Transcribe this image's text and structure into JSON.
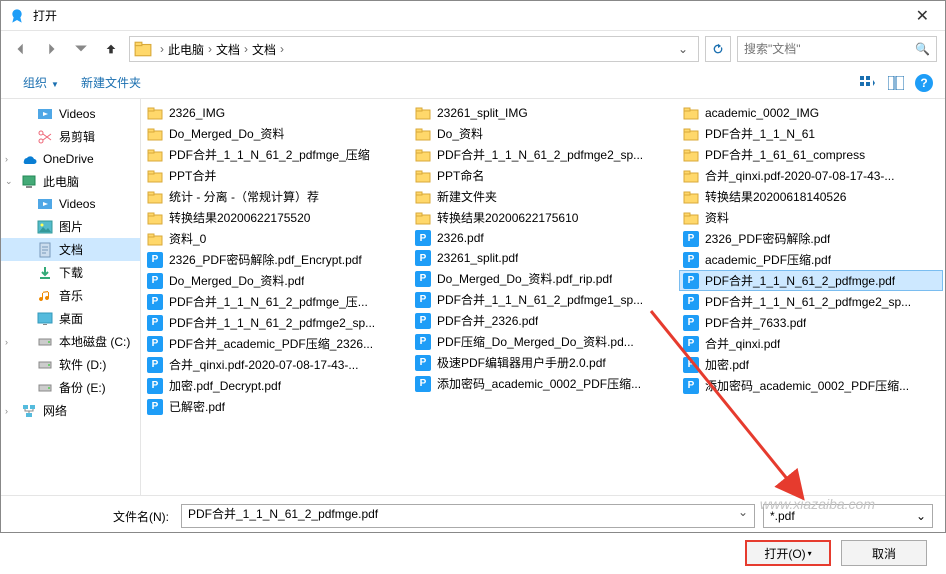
{
  "window": {
    "title": "打开"
  },
  "breadcrumb": {
    "root_icon": "folder",
    "items": [
      "此电脑",
      "文档",
      "文档"
    ]
  },
  "search": {
    "placeholder": "搜索\"文档\""
  },
  "toolbar": {
    "organize": "组织",
    "new_folder": "新建文件夹"
  },
  "sidebar": [
    {
      "label": "Videos",
      "icon": "video",
      "sub": true
    },
    {
      "label": "易剪辑",
      "icon": "scissors",
      "sub": true
    },
    {
      "label": "OneDrive",
      "icon": "onedrive",
      "caret": ">"
    },
    {
      "label": "此电脑",
      "icon": "pc",
      "caret": "v"
    },
    {
      "label": "Videos",
      "icon": "video",
      "sub": true
    },
    {
      "label": "图片",
      "icon": "pictures",
      "sub": true
    },
    {
      "label": "文档",
      "icon": "documents",
      "sub": true,
      "selected": true
    },
    {
      "label": "下载",
      "icon": "downloads",
      "sub": true
    },
    {
      "label": "音乐",
      "icon": "music",
      "sub": true
    },
    {
      "label": "桌面",
      "icon": "desktop",
      "sub": true
    },
    {
      "label": "本地磁盘 (C:)",
      "icon": "disk",
      "sub": true,
      "caret": ">"
    },
    {
      "label": "软件 (D:)",
      "icon": "disk",
      "sub": true
    },
    {
      "label": "备份 (E:)",
      "icon": "disk",
      "sub": true
    },
    {
      "label": "网络",
      "icon": "network",
      "caret": ">"
    }
  ],
  "files": {
    "col1": [
      {
        "t": "folder",
        "n": "2326_IMG"
      },
      {
        "t": "folder",
        "n": "Do_Merged_Do_资料"
      },
      {
        "t": "folder",
        "n": "PDF合并_1_1_N_61_2_pdfmge_压缩"
      },
      {
        "t": "folder",
        "n": "PPT合并"
      },
      {
        "t": "folder",
        "n": "统计 - 分离 -（常规计算）荐"
      },
      {
        "t": "folder",
        "n": "转换结果20200622175520"
      },
      {
        "t": "folder",
        "n": "资料_0"
      },
      {
        "t": "pdf",
        "n": "2326_PDF密码解除.pdf_Encrypt.pdf"
      },
      {
        "t": "pdf",
        "n": "Do_Merged_Do_资料.pdf"
      },
      {
        "t": "pdf",
        "n": "PDF合并_1_1_N_61_2_pdfmge_压..."
      },
      {
        "t": "pdf",
        "n": "PDF合并_1_1_N_61_2_pdfmge2_sp..."
      },
      {
        "t": "pdf",
        "n": "PDF合并_academic_PDF压缩_2326..."
      },
      {
        "t": "pdf",
        "n": "合并_qinxi.pdf-2020-07-08-17-43-..."
      },
      {
        "t": "pdf",
        "n": "加密.pdf_Decrypt.pdf"
      },
      {
        "t": "pdf",
        "n": "已解密.pdf"
      }
    ],
    "col2": [
      {
        "t": "folder",
        "n": "23261_split_IMG"
      },
      {
        "t": "folder",
        "n": "Do_资料"
      },
      {
        "t": "folder",
        "n": "PDF合并_1_1_N_61_2_pdfmge2_sp..."
      },
      {
        "t": "folder",
        "n": "PPT命名"
      },
      {
        "t": "folder",
        "n": "新建文件夹"
      },
      {
        "t": "folder",
        "n": "转换结果20200622175610"
      },
      {
        "t": "pdf",
        "n": "2326.pdf"
      },
      {
        "t": "pdf",
        "n": "23261_split.pdf"
      },
      {
        "t": "pdf",
        "n": "Do_Merged_Do_资料.pdf_rip.pdf"
      },
      {
        "t": "pdf",
        "n": "PDF合并_1_1_N_61_2_pdfmge1_sp..."
      },
      {
        "t": "pdf",
        "n": "PDF合并_2326.pdf"
      },
      {
        "t": "pdf",
        "n": "PDF压缩_Do_Merged_Do_资料.pd..."
      },
      {
        "t": "pdf",
        "n": "极速PDF编辑器用户手册2.0.pdf"
      },
      {
        "t": "pdf",
        "n": "添加密码_academic_0002_PDF压缩..."
      }
    ],
    "col3": [
      {
        "t": "folder",
        "n": "academic_0002_IMG"
      },
      {
        "t": "folder",
        "n": "PDF合并_1_1_N_61"
      },
      {
        "t": "folder",
        "n": "PDF合并_1_61_61_compress"
      },
      {
        "t": "folder",
        "n": "合并_qinxi.pdf-2020-07-08-17-43-..."
      },
      {
        "t": "folder",
        "n": "转换结果20200618140526"
      },
      {
        "t": "folder",
        "n": "资料"
      },
      {
        "t": "pdf",
        "n": "2326_PDF密码解除.pdf"
      },
      {
        "t": "pdf",
        "n": "academic_PDF压缩.pdf"
      },
      {
        "t": "pdf",
        "n": "PDF合并_1_1_N_61_2_pdfmge.pdf",
        "selected": true
      },
      {
        "t": "pdf",
        "n": "PDF合并_1_1_N_61_2_pdfmge2_sp..."
      },
      {
        "t": "pdf",
        "n": "PDF合并_7633.pdf"
      },
      {
        "t": "pdf",
        "n": "合并_qinxi.pdf"
      },
      {
        "t": "pdf",
        "n": "加密.pdf"
      },
      {
        "t": "pdf",
        "n": "添加密码_academic_0002_PDF压缩..."
      }
    ]
  },
  "footer": {
    "filename_label": "文件名(N):",
    "filename_value": "PDF合并_1_1_N_61_2_pdfmge.pdf",
    "filter": "*.pdf",
    "open": "打开(O)",
    "cancel": "取消"
  },
  "watermark": "www.xiazaiba.com"
}
